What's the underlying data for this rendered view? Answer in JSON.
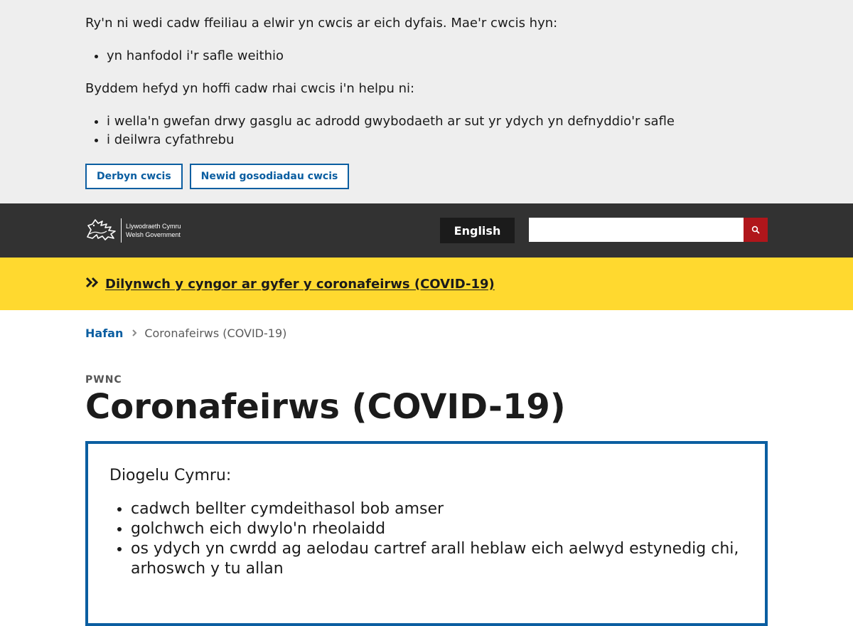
{
  "cookie_banner": {
    "intro": "Ry'n ni wedi cadw ffeiliau a elwir yn cwcis ar eich dyfais. Mae'r cwcis hyn:",
    "essential": [
      "yn hanfodol i'r safle weithio"
    ],
    "also": "Byddem hefyd yn hoffi cadw rhai cwcis i'n helpu ni:",
    "optional": [
      "i wella'n gwefan drwy gasglu ac adrodd gwybodaeth ar sut yr ydych yn defnyddio'r safle",
      "i deilwra cyfathrebu"
    ],
    "accept_label": "Derbyn cwcis",
    "settings_label": "Newid gosodiadau cwcis"
  },
  "header": {
    "logo_line1": "Llywodraeth Cymru",
    "logo_line2": "Welsh Government",
    "language_label": "English",
    "search_value": "",
    "icons": {
      "search": "search-icon",
      "logo": "dragon-logo-icon"
    }
  },
  "covid_banner": {
    "link_text": "Dilynwch y cyngor ar gyfer y coronafeirws (COVID-19)",
    "icon": "double-chevron-right-icon"
  },
  "breadcrumb": {
    "home": "Hafan",
    "current": "Coronafeirws (COVID-19)"
  },
  "page": {
    "kicker": "PWNC",
    "title": "Coronafeirws (COVID-19)"
  },
  "callout": {
    "heading": "Diogelu Cymru:",
    "items": [
      "cadwch bellter cymdeithasol bob amser",
      "golchwch eich dwylo'n rheolaidd",
      "os ydych yn cwrdd ag aelodau cartref arall heblaw eich aelwyd estynedig chi, arhoswch y tu allan"
    ]
  },
  "colors": {
    "primary_blue": "#0b5ea1",
    "header_dark": "#323232",
    "banner_yellow": "#ffd92f",
    "search_red": "#b0161b"
  }
}
